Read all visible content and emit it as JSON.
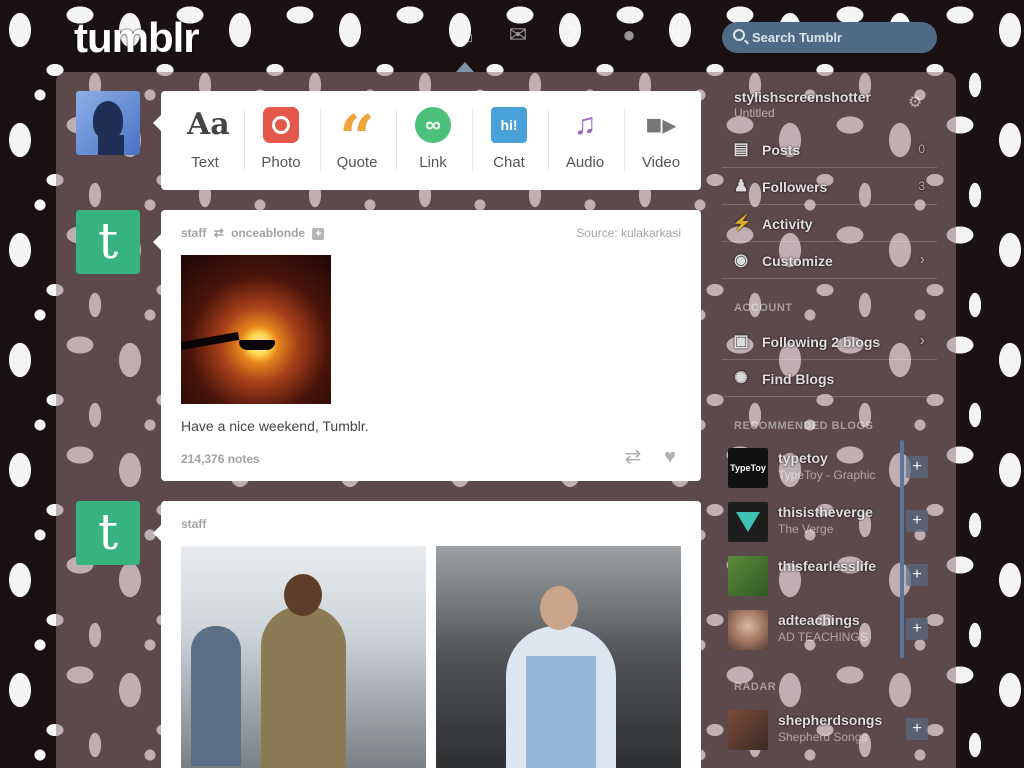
{
  "header": {
    "logo": "tumblr",
    "nav": [
      "home-icon",
      "mail-icon",
      "help-icon",
      "account-icon",
      "lightning-icon"
    ],
    "search_placeholder": "Search Tumblr"
  },
  "composer": {
    "items": [
      {
        "label": "Text",
        "icon": "Aa"
      },
      {
        "label": "Photo",
        "icon": "camera-icon"
      },
      {
        "label": "Quote",
        "icon": "“"
      },
      {
        "label": "Link",
        "icon": "link-icon"
      },
      {
        "label": "Chat",
        "icon": "hi!"
      },
      {
        "label": "Audio",
        "icon": "headphones-icon"
      },
      {
        "label": "Video",
        "icon": "video-camera-icon"
      }
    ]
  },
  "posts": [
    {
      "author": "staff",
      "reblogged_from": "onceablonde",
      "source": "Source: kulakarkasi",
      "caption": "Have a nice weekend, Tumblr.",
      "notes": "214,376 notes"
    },
    {
      "author": "staff"
    }
  ],
  "sidebar": {
    "blog": {
      "name": "stylishscreenshotter",
      "subtitle": "Untitled"
    },
    "rows": [
      {
        "label": "Posts",
        "count": "0",
        "icon": "posts-icon"
      },
      {
        "label": "Followers",
        "count": "3",
        "icon": "followers-icon"
      },
      {
        "label": "Activity",
        "count": "",
        "icon": "activity-icon"
      },
      {
        "label": "Customize",
        "count": "",
        "icon": "eye-icon"
      }
    ],
    "account_heading": "ACCOUNT",
    "account_rows": [
      {
        "label": "Following 2 blogs",
        "icon": "following-icon"
      },
      {
        "label": "Find Blogs",
        "icon": "find-blogs-icon"
      }
    ],
    "recommended_heading": "RECOMMENDED BLOGS",
    "recommended": [
      {
        "name": "typetoy",
        "desc": "TypeToy - Graphic",
        "thumb": "TypeToy"
      },
      {
        "name": "thisistheverge",
        "desc": "The Verge",
        "thumb": ""
      },
      {
        "name": "thisfearlesslife",
        "desc": "",
        "thumb": ""
      },
      {
        "name": "adteachings",
        "desc": "AD TEACHINGS",
        "thumb": ""
      }
    ],
    "radar_heading": "RADAR",
    "radar": {
      "name": "shepherdsongs",
      "desc": "Shepherd Songs"
    }
  }
}
